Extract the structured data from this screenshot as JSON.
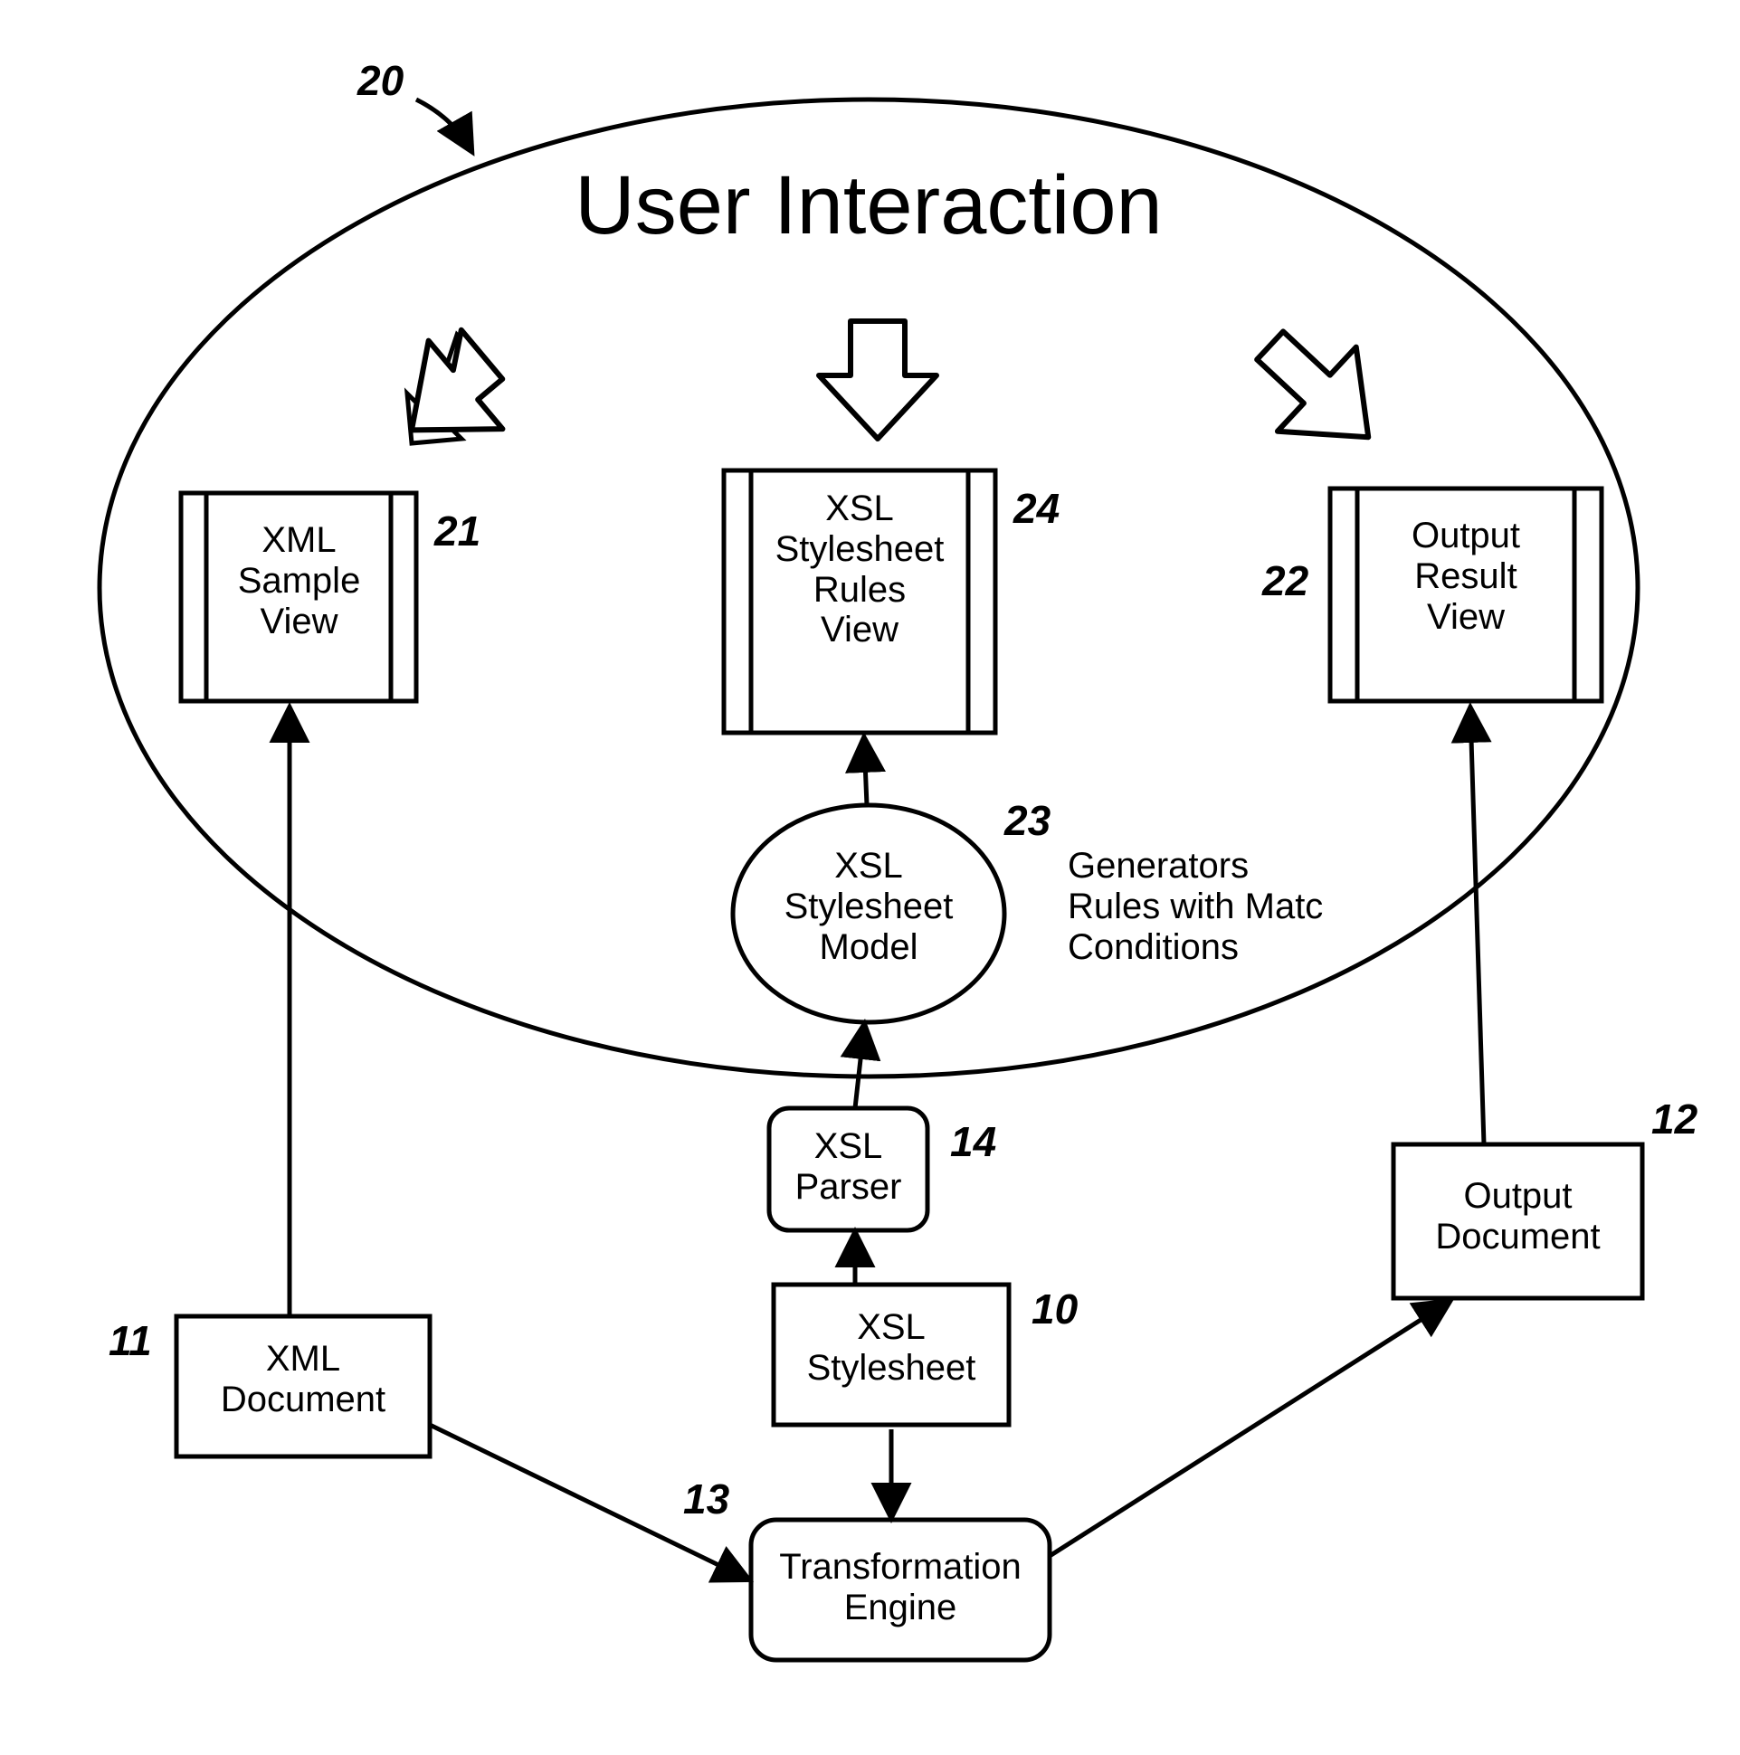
{
  "title": "User Interaction",
  "nodes": {
    "xml_sample_view": "XML\nSample\nView",
    "xsl_rules_view": "XSL\nStylesheet\nRules\nView",
    "output_result_view": "Output\nResult\nView",
    "xsl_stylesheet_model": "XSL\nStylesheet\nModel",
    "xsl_parser": "XSL\nParser",
    "xsl_stylesheet": "XSL\nStylesheet",
    "xml_document": "XML\nDocument",
    "output_document": "Output\nDocument",
    "transformation_engine": "Transformation\nEngine"
  },
  "side_text": "Generators\nRules with Matc\nConditions",
  "refs": {
    "r20": "20",
    "r21": "21",
    "r24": "24",
    "r22": "22",
    "r23": "23",
    "r14": "14",
    "r10": "10",
    "r11": "11",
    "r12": "12",
    "r13": "13"
  }
}
